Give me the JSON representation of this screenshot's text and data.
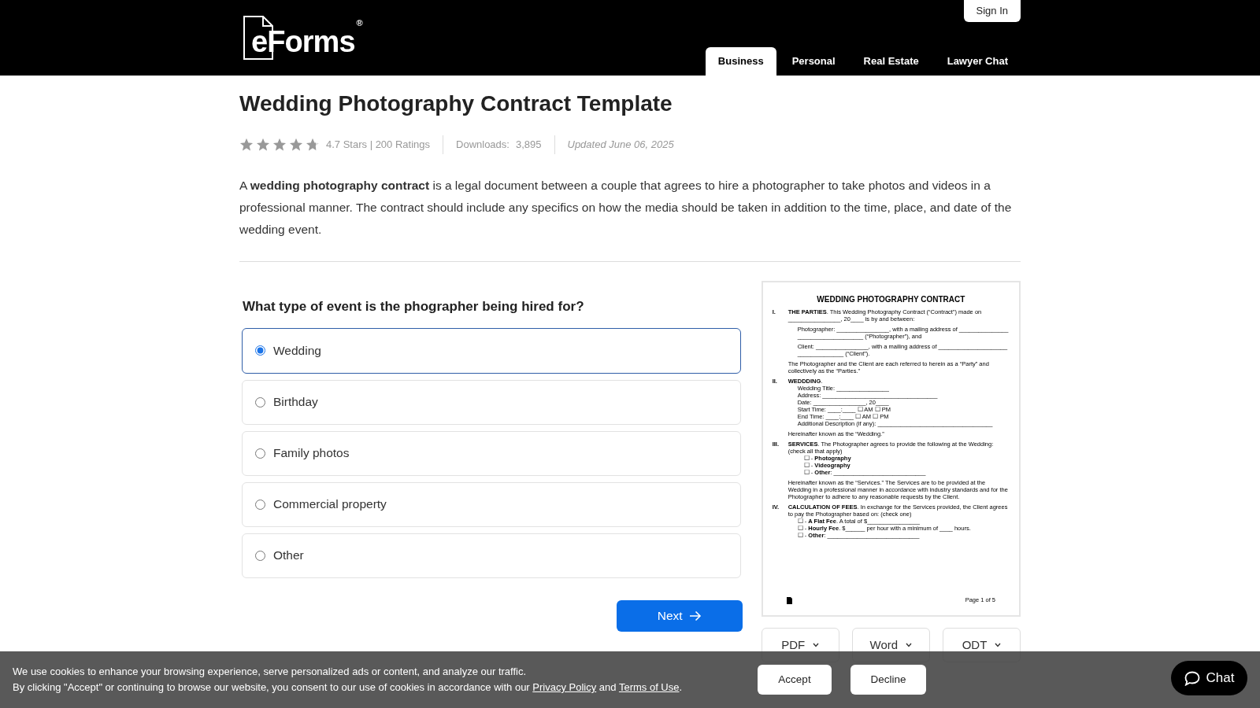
{
  "header": {
    "logo": "eForms$^{®}$",
    "sign_in": "Sign In",
    "tabs": [
      {
        "label": "Business",
        "selected": true
      },
      {
        "label": "Personal",
        "selected": false
      },
      {
        "label": "Real Estate",
        "selected": false
      },
      {
        "label": "Lawyer Chat",
        "selected": false
      }
    ]
  },
  "title": "Wedding Photography Contract Template",
  "rating": {
    "stars": 4.7,
    "summary": "4.7 Stars | 200 Ratings",
    "downloads_label": "Downloads:",
    "downloads": "3,895",
    "updated": "Updated June 06, 2025"
  },
  "intro": "A **wedding photography contract** is a legal document between a couple that agrees to hire a photographer to take photos and videos in a professional manner. The contract should include any specifics on how the media should be taken in addition to the time, place, and date of the wedding event.",
  "question": {
    "text": "What type of event is the phographer being hired for?",
    "options": [
      {
        "label": "Wedding",
        "selected": true
      },
      {
        "label": "Birthday",
        "selected": false
      },
      {
        "label": "Family photos",
        "selected": false
      },
      {
        "label": "Commercial property",
        "selected": false
      },
      {
        "label": "Other",
        "selected": false
      }
    ],
    "next": "Next"
  },
  "preview": {
    "blocks": [
      {
        "kind": "title",
        "text": "WEDDING PHOTOGRAPHY CONTRACT"
      },
      {
        "kind": "section",
        "number": "I.",
        "text": "**THE PARTIES**. This Wedding Photography Contract (“Contract”) made on ________________, 20____ is by and between:"
      },
      {
        "kind": "sub",
        "text": "Photographer: ________________, with a mailing address of ___________________________________ (“Photographer”), and"
      },
      {
        "kind": "sub",
        "text": "Client: ________________, with a mailing address of ___________________________________ (“Client”)."
      },
      {
        "kind": "text",
        "text": "The Photographer and the Client are each referred to herein as a “Party” and collectively as the “Parties.”"
      },
      {
        "kind": "section",
        "number": "II.",
        "text": "**WEDDDING**."
      },
      {
        "kind": "line",
        "text": "Wedding Title: ________________"
      },
      {
        "kind": "line",
        "text": "Address: ___________________________________"
      },
      {
        "kind": "line",
        "text": "Date: ________________, 20____"
      },
      {
        "kind": "line",
        "text": "Start Time: ____:____ ☐ AM ☐ PM"
      },
      {
        "kind": "line",
        "text": "End Time: ____:____ ☐ AM ☐ PM"
      },
      {
        "kind": "line",
        "text": "Additional Description (if any): ___________________________________"
      },
      {
        "kind": "text",
        "text": "Hereinafter known as the “Wedding.”"
      },
      {
        "kind": "section",
        "number": "III.",
        "text": "**SERVICES**. The Photographer agrees to provide the following at the Wedding: (check all that apply)"
      },
      {
        "kind": "check",
        "text": "☐ - **Photography**"
      },
      {
        "kind": "check",
        "text": "☐ - **Videography**"
      },
      {
        "kind": "check",
        "text": "☐ - **Other**: ____________________________"
      },
      {
        "kind": "text",
        "text": "Hereinafter known as the “Services.” The Services are to be provided at the Wedding in a professional manner in accordance with industry standards and for the Photographer to adhere to any reasonable requests by the Client."
      },
      {
        "kind": "section",
        "number": "IV.",
        "text": "**CALCULATION OF FEES**. In exchange for the Services provided, the Client agrees to pay the Photographer based on: (check one)"
      },
      {
        "kind": "fee",
        "text": "☐ - **A Flat Fee**. A total of $________________"
      },
      {
        "kind": "fee",
        "text": "☐ - **Hourly Fee**. $______ per hour with a minimum of ____ hours."
      },
      {
        "kind": "fee",
        "text": "☐ - **Other**: ____________________________"
      }
    ],
    "page": "Page 1 of 5"
  },
  "formats": [
    {
      "label": "PDF"
    },
    {
      "label": "Word"
    },
    {
      "label": "ODT"
    }
  ],
  "cookies": {
    "line1": "We use cookies to enhance your browsing experience, serve personalized ads or content, and analyze our traffic.",
    "consent": [
      {
        "kind": "text",
        "text": "By clicking \"Accept\" or continuing to browse our website, you consent to our use of cookies in accordance with our "
      },
      {
        "kind": "link",
        "text": "Privacy Policy"
      },
      {
        "kind": "text",
        "text": " and "
      },
      {
        "kind": "link",
        "text": "Terms of Use"
      },
      {
        "kind": "text",
        "text": "."
      }
    ],
    "accept": "Accept",
    "decline": "Decline"
  },
  "chat": "Chat"
}
